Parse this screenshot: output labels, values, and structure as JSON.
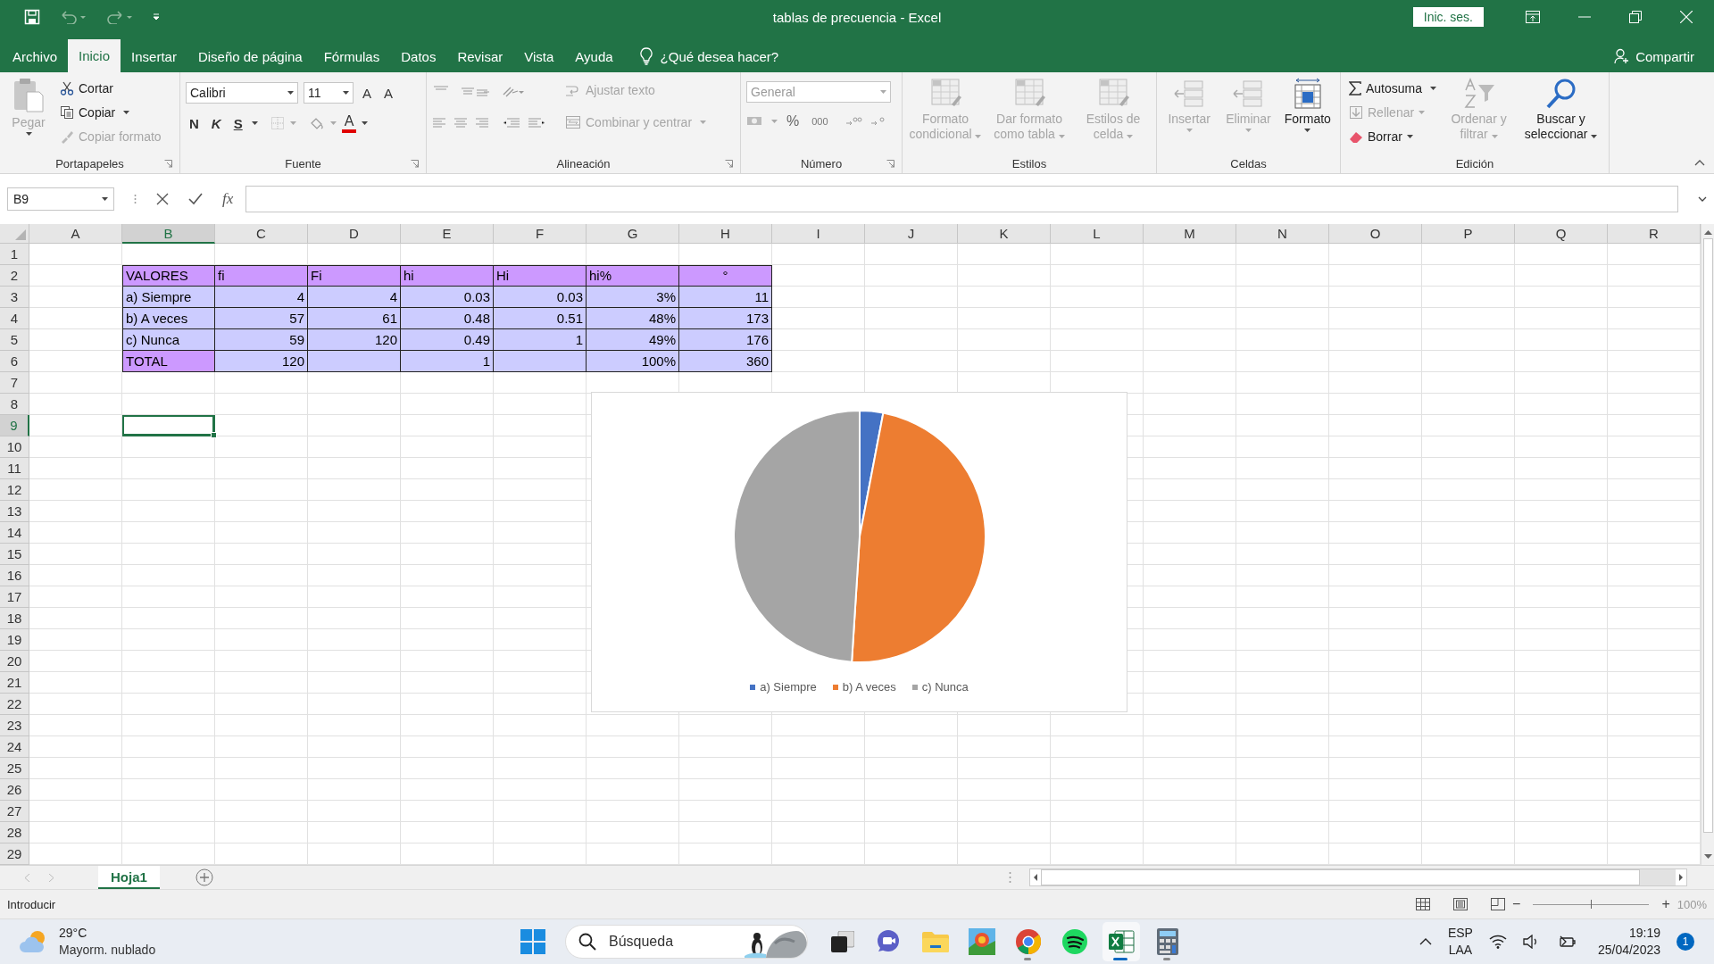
{
  "window": {
    "title": "tablas de precuencia  -  Excel",
    "sign_in": "Inic. ses."
  },
  "menu_tabs": [
    {
      "label": "Archivo",
      "selected": false
    },
    {
      "label": "Inicio",
      "selected": true
    },
    {
      "label": "Insertar",
      "selected": false
    },
    {
      "label": "Diseño de página",
      "selected": false
    },
    {
      "label": "Fórmulas",
      "selected": false
    },
    {
      "label": "Datos",
      "selected": false
    },
    {
      "label": "Revisar",
      "selected": false
    },
    {
      "label": "Vista",
      "selected": false
    },
    {
      "label": "Ayuda",
      "selected": false
    }
  ],
  "tell_me": "¿Qué desea hacer?",
  "share": "Compartir",
  "ribbon": {
    "groups": [
      {
        "label": "Portapapeles",
        "items": [
          {
            "label": "Pegar",
            "disabled": true
          },
          {
            "label": "Cortar",
            "disabled": false
          },
          {
            "label": "Copiar",
            "disabled": false
          },
          {
            "label": "Copiar formato",
            "disabled": true
          }
        ]
      },
      {
        "label": "Fuente",
        "font": "Calibri",
        "size": "11",
        "items": [
          {
            "label": "A"
          },
          {
            "label": "A"
          },
          {
            "label": "N"
          },
          {
            "label": "K"
          },
          {
            "label": "S"
          },
          {
            "label": "A"
          }
        ]
      },
      {
        "label": "Alineación",
        "items": [
          {
            "label": "Ajustar texto",
            "disabled": true
          },
          {
            "label": "Combinar y centrar",
            "disabled": true
          }
        ]
      },
      {
        "label": "Número",
        "format": "General",
        "items": [
          {
            "label": "%"
          },
          {
            "label": "000"
          }
        ]
      },
      {
        "label": "Estilos",
        "items": [
          {
            "label": "Formato condicional",
            "disabled": true
          },
          {
            "label": "Dar formato como tabla",
            "disabled": true
          },
          {
            "label": "Estilos de celda",
            "disabled": true
          }
        ]
      },
      {
        "label": "Celdas",
        "items": [
          {
            "label": "Insertar",
            "disabled": true
          },
          {
            "label": "Eliminar",
            "disabled": true
          },
          {
            "label": "Formato",
            "disabled": false
          }
        ]
      },
      {
        "label": "Edición",
        "items": [
          {
            "label": "Autosuma",
            "disabled": false
          },
          {
            "label": "Rellenar",
            "disabled": true
          },
          {
            "label": "Borrar",
            "disabled": false
          },
          {
            "label": "Ordenar y filtrar",
            "disabled": true
          },
          {
            "label": "Buscar y seleccionar",
            "disabled": false
          }
        ]
      }
    ]
  },
  "formula_bar": {
    "name_box": "B9",
    "function_button": "fx"
  },
  "sheet": {
    "columns": [
      {
        "label": "A",
        "selected": false
      },
      {
        "label": "B",
        "selected": true
      },
      {
        "label": "C",
        "selected": false
      },
      {
        "label": "D",
        "selected": false
      },
      {
        "label": "E",
        "selected": false
      },
      {
        "label": "F",
        "selected": false
      },
      {
        "label": "G",
        "selected": false
      },
      {
        "label": "H",
        "selected": false
      },
      {
        "label": "I",
        "selected": false
      },
      {
        "label": "J",
        "selected": false
      },
      {
        "label": "K",
        "selected": false
      },
      {
        "label": "L",
        "selected": false
      },
      {
        "label": "M",
        "selected": false
      },
      {
        "label": "N",
        "selected": false
      },
      {
        "label": "O",
        "selected": false
      },
      {
        "label": "P",
        "selected": false
      },
      {
        "label": "Q",
        "selected": false
      },
      {
        "label": "R",
        "selected": false
      }
    ],
    "rows": [
      {
        "label": "1",
        "selected": false
      },
      {
        "label": "2",
        "selected": false
      },
      {
        "label": "3",
        "selected": false
      },
      {
        "label": "4",
        "selected": false
      },
      {
        "label": "5",
        "selected": false
      },
      {
        "label": "6",
        "selected": false
      },
      {
        "label": "7",
        "selected": false
      },
      {
        "label": "8",
        "selected": false
      },
      {
        "label": "9",
        "selected": true
      },
      {
        "label": "10",
        "selected": false
      },
      {
        "label": "11",
        "selected": false
      },
      {
        "label": "12",
        "selected": false
      },
      {
        "label": "13",
        "selected": false
      },
      {
        "label": "14",
        "selected": false
      },
      {
        "label": "15",
        "selected": false
      },
      {
        "label": "16",
        "selected": false
      },
      {
        "label": "17",
        "selected": false
      },
      {
        "label": "18",
        "selected": false
      },
      {
        "label": "19",
        "selected": false
      },
      {
        "label": "20",
        "selected": false
      },
      {
        "label": "21",
        "selected": false
      },
      {
        "label": "22",
        "selected": false
      },
      {
        "label": "23",
        "selected": false
      },
      {
        "label": "24",
        "selected": false
      },
      {
        "label": "25",
        "selected": false
      },
      {
        "label": "26",
        "selected": false
      },
      {
        "label": "27",
        "selected": false
      },
      {
        "label": "28",
        "selected": false
      },
      {
        "label": "29",
        "selected": false
      }
    ]
  },
  "table": {
    "header": [
      "VALORES",
      "fi",
      "Fi",
      "hi",
      "Hi",
      "hi%",
      "°"
    ],
    "rows": [
      {
        "kind": "data",
        "cells": [
          "a) Siempre",
          "4",
          "4",
          "0.03",
          "0.03",
          "3%",
          "11"
        ]
      },
      {
        "kind": "data",
        "cells": [
          "b) A veces",
          "57",
          "61",
          "0.48",
          "0.51",
          "48%",
          "173"
        ]
      },
      {
        "kind": "data",
        "cells": [
          "c) Nunca",
          "59",
          "120",
          "0.49",
          "1",
          "49%",
          "176"
        ]
      },
      {
        "kind": "total",
        "cells": [
          "TOTAL",
          "120",
          null,
          "1",
          null,
          "100%",
          "360"
        ]
      }
    ]
  },
  "chart": {
    "chart_data": {
      "type": "pie",
      "categories": [
        "a) Siempre",
        "b) A veces",
        "c) Nunca"
      ],
      "values": [
        3,
        48,
        49
      ],
      "legend": "bottom"
    }
  },
  "sheet_tabs": [
    {
      "label": "Hoja1",
      "selected": true
    }
  ],
  "status_bar": {
    "mode": "Introducir",
    "zoom": "100%",
    "zoom_out": "−",
    "zoom_in": "+",
    "zoom_slider": {
      "level": 0.5
    }
  },
  "taskbar": {
    "weather": {
      "temperature": "29°C",
      "condition": "Mayorm. nublado"
    },
    "search": {
      "placeholder": "Búsqueda"
    },
    "apps": [
      {
        "kind": "taskview",
        "running": false,
        "selected": false
      },
      {
        "kind": "chat",
        "running": false,
        "selected": false
      },
      {
        "kind": "files",
        "running": false,
        "selected": false
      },
      {
        "kind": "game",
        "running": false,
        "selected": false
      },
      {
        "kind": "chrome",
        "running": true,
        "selected": false
      },
      {
        "kind": "spotify",
        "running": false,
        "selected": false
      },
      {
        "kind": "excel",
        "running": true,
        "selected": true
      },
      {
        "kind": "calculator",
        "running": true,
        "selected": false
      }
    ],
    "tray": {
      "language": "ESP",
      "layout": "LAA",
      "time": "19:19",
      "date": "25/04/2023",
      "notifications": "1"
    }
  }
}
